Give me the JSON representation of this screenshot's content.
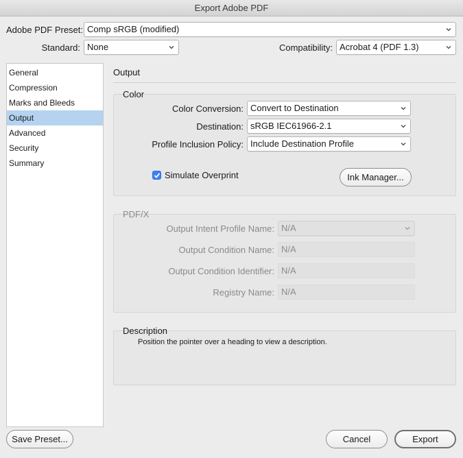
{
  "window": {
    "title": "Export Adobe PDF"
  },
  "top": {
    "preset_label": "Adobe PDF Preset:",
    "preset_value": "Comp sRGB (modified)",
    "standard_label": "Standard:",
    "standard_value": "None",
    "compat_label": "Compatibility:",
    "compat_value": "Acrobat 4 (PDF 1.3)"
  },
  "sidebar": {
    "items": [
      {
        "label": "General"
      },
      {
        "label": "Compression"
      },
      {
        "label": "Marks and Bleeds"
      },
      {
        "label": "Output",
        "selected": true
      },
      {
        "label": "Advanced"
      },
      {
        "label": "Security"
      },
      {
        "label": "Summary"
      }
    ]
  },
  "main": {
    "heading": "Output",
    "color": {
      "title": "Color",
      "conversion_label": "Color Conversion:",
      "conversion_value": "Convert to Destination",
      "destination_label": "Destination:",
      "destination_value": "sRGB IEC61966-2.1",
      "policy_label": "Profile Inclusion Policy:",
      "policy_value": "Include Destination Profile",
      "simulate_label": "Simulate Overprint",
      "simulate_checked": true,
      "ink_manager_label": "Ink Manager..."
    },
    "pdfx": {
      "title": "PDF/X",
      "intent_label": "Output Intent Profile Name:",
      "intent_value": "N/A",
      "condition_name_label": "Output Condition Name:",
      "condition_name_value": "N/A",
      "condition_id_label": "Output Condition Identifier:",
      "condition_id_value": "N/A",
      "registry_label": "Registry Name:",
      "registry_value": "N/A"
    },
    "description": {
      "title": "Description",
      "text": "Position the pointer over a heading to view a description."
    }
  },
  "footer": {
    "save_preset_label": "Save Preset...",
    "cancel_label": "Cancel",
    "export_label": "Export"
  },
  "colors": {
    "selection": "#b5d3f1",
    "checkbox": "#3b82f6"
  }
}
